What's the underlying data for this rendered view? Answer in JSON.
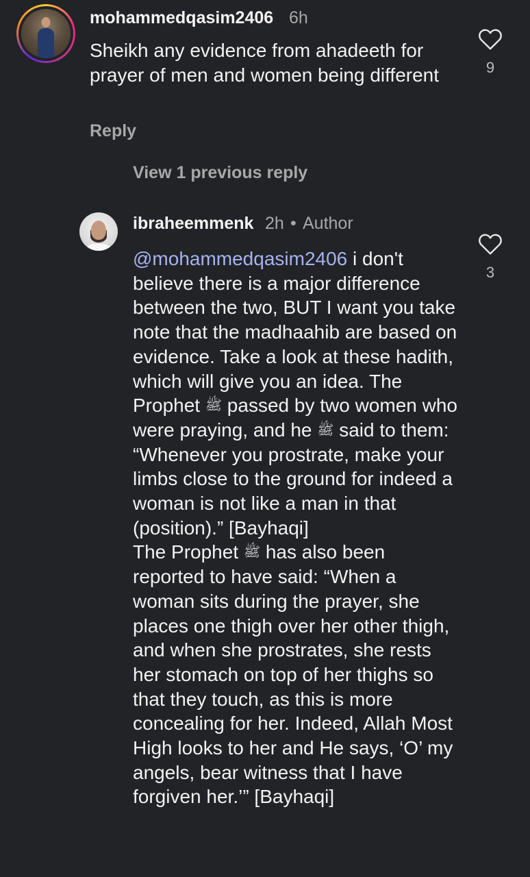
{
  "comment": {
    "username": "mohammedqasim2406",
    "time": "6h",
    "text": "Sheikh any evidence from ahadeeth for prayer of men and women being different",
    "reply_label": "Reply",
    "like_count": "9",
    "view_replies_label": "View 1 previous reply"
  },
  "reply": {
    "username": "ibraheemmenk",
    "time": "2h",
    "separator": "•",
    "author_badge": "Author",
    "like_count": "3",
    "mention": "@mohammedqasim2406",
    "salawat": "ﷺ",
    "seg1": " i don't believe there is a major difference between the two, BUT I want you take note that the madhaahib are based on evidence. Take a look at these hadith, which will give you an idea. The Prophet ",
    "seg2": " passed by two women who were praying, and he ",
    "seg3": " said to them: “Whenever you prostrate, make your limbs close to the ground for indeed a woman is not like a man in that (position).” [Bayhaqi]",
    "seg4": "The Prophet ",
    "seg5": " has also been reported to have said: “When a woman sits during the prayer, she places one thigh over her other thigh, and when she prostrates, she rests her stomach on top of her thighs so that they touch, as this is more concealing for her. Indeed, Allah Most High looks to her and He says, ‘O’ my angels, bear witness that I have forgiven her.’” [Bayhaqi]"
  }
}
